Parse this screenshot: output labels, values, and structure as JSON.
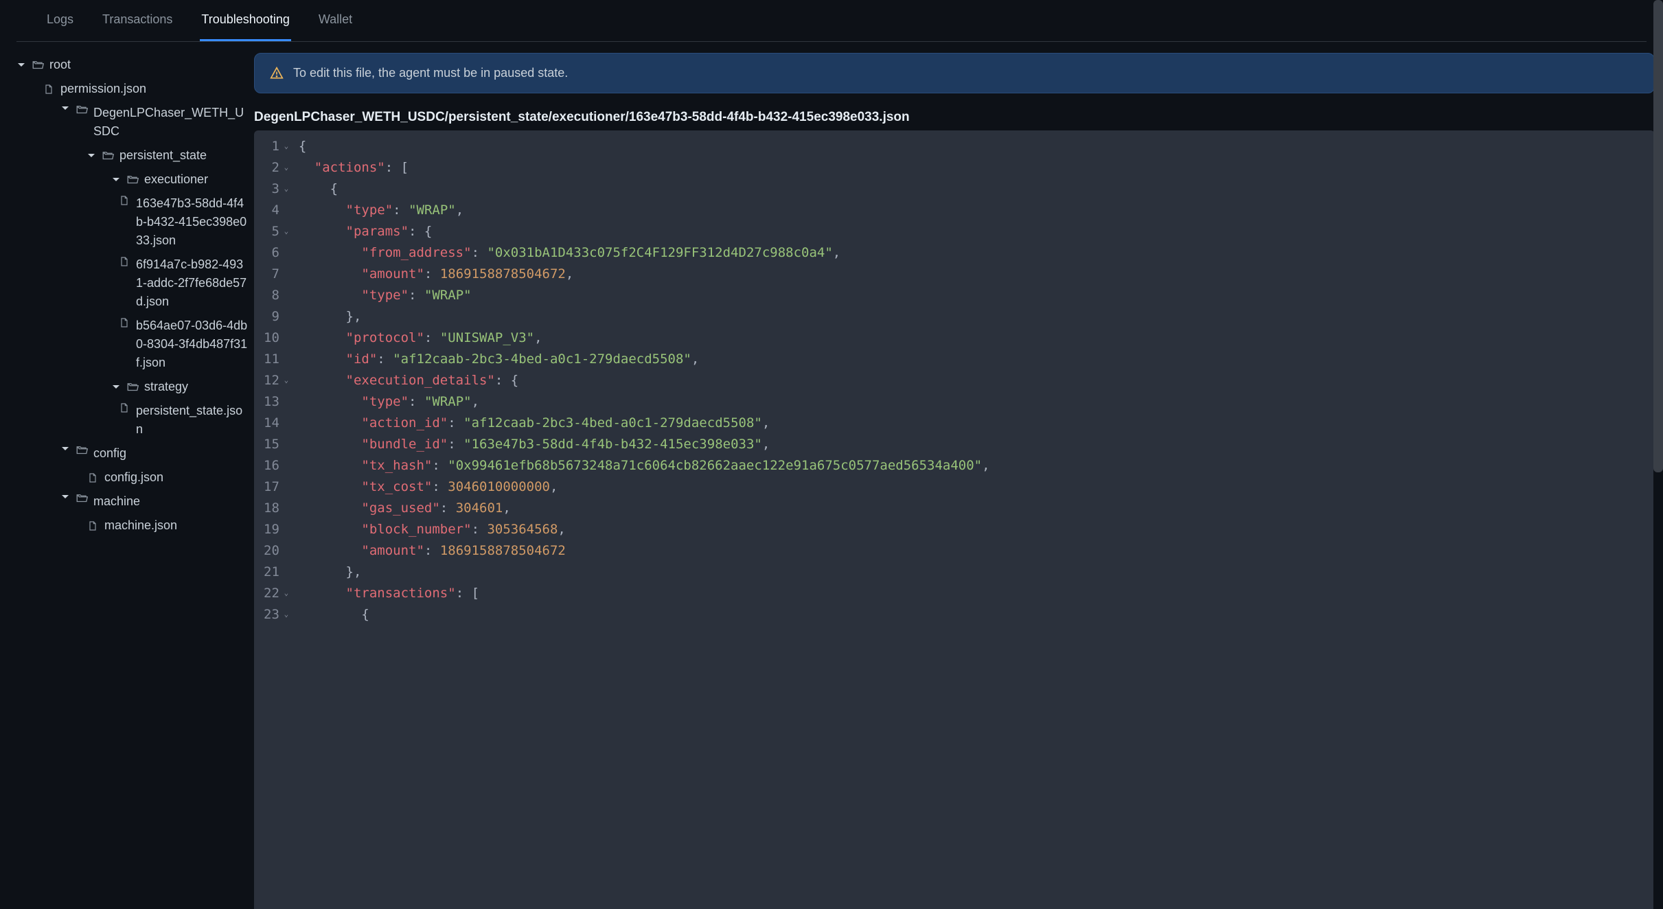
{
  "tabs": {
    "items": [
      {
        "label": "Logs",
        "active": false
      },
      {
        "label": "Transactions",
        "active": false
      },
      {
        "label": "Troubleshooting",
        "active": true
      },
      {
        "label": "Wallet",
        "active": false
      }
    ]
  },
  "sidebar": {
    "tree": [
      {
        "indent": 0,
        "kind": "folder",
        "expanded": true,
        "label": "root"
      },
      {
        "indent": 1,
        "kind": "file",
        "label": "permission.json"
      },
      {
        "indent": 2,
        "kind": "folder",
        "expanded": true,
        "label": "DegenLPChaser_WETH_USDC"
      },
      {
        "indent": 3,
        "kind": "folder",
        "expanded": true,
        "label": "persistent_state"
      },
      {
        "indent": 4,
        "kind": "folder",
        "expanded": true,
        "label": "executioner"
      },
      {
        "indent": 5,
        "kind": "file",
        "label": "163e47b3-58dd-4f4b-b432-415ec398e033.json"
      },
      {
        "indent": 5,
        "kind": "file",
        "label": "6f914a7c-b982-4931-addc-2f7fe68de57d.json"
      },
      {
        "indent": 5,
        "kind": "file",
        "label": "b564ae07-03d6-4db0-8304-3f4db487f31f.json"
      },
      {
        "indent": 4,
        "kind": "folder",
        "expanded": true,
        "label": "strategy"
      },
      {
        "indent": 5,
        "kind": "file",
        "label": "persistent_state.json"
      },
      {
        "indent": 2,
        "kind": "folder",
        "expanded": true,
        "label": "config"
      },
      {
        "indent": 3,
        "kind": "file",
        "label": "config.json"
      },
      {
        "indent": 2,
        "kind": "folder",
        "expanded": true,
        "label": "machine"
      },
      {
        "indent": 3,
        "kind": "file",
        "label": "machine.json"
      }
    ]
  },
  "alert": {
    "text": "To edit this file, the agent must be in paused state."
  },
  "file": {
    "path": "DegenLPChaser_WETH_USDC/persistent_state/executioner/163e47b3-58dd-4f4b-b432-415ec398e033.json"
  },
  "editor": {
    "lines": [
      {
        "n": 1,
        "fold": true,
        "tokens": [
          [
            "pun",
            "{"
          ]
        ]
      },
      {
        "n": 2,
        "fold": true,
        "tokens": [
          [
            "pun",
            "  "
          ],
          [
            "key",
            "\"actions\""
          ],
          [
            "pun",
            ": ["
          ]
        ]
      },
      {
        "n": 3,
        "fold": true,
        "tokens": [
          [
            "pun",
            "    {"
          ]
        ]
      },
      {
        "n": 4,
        "fold": false,
        "tokens": [
          [
            "pun",
            "      "
          ],
          [
            "key",
            "\"type\""
          ],
          [
            "pun",
            ": "
          ],
          [
            "str",
            "\"WRAP\""
          ],
          [
            "pun",
            ","
          ]
        ]
      },
      {
        "n": 5,
        "fold": true,
        "tokens": [
          [
            "pun",
            "      "
          ],
          [
            "key",
            "\"params\""
          ],
          [
            "pun",
            ": {"
          ]
        ]
      },
      {
        "n": 6,
        "fold": false,
        "tokens": [
          [
            "pun",
            "        "
          ],
          [
            "key",
            "\"from_address\""
          ],
          [
            "pun",
            ": "
          ],
          [
            "str",
            "\"0x031bA1D433c075f2C4F129FF312d4D27c988c0a4\""
          ],
          [
            "pun",
            ","
          ]
        ]
      },
      {
        "n": 7,
        "fold": false,
        "tokens": [
          [
            "pun",
            "        "
          ],
          [
            "key",
            "\"amount\""
          ],
          [
            "pun",
            ": "
          ],
          [
            "num",
            "1869158878504672"
          ],
          [
            "pun",
            ","
          ]
        ]
      },
      {
        "n": 8,
        "fold": false,
        "tokens": [
          [
            "pun",
            "        "
          ],
          [
            "key",
            "\"type\""
          ],
          [
            "pun",
            ": "
          ],
          [
            "str",
            "\"WRAP\""
          ]
        ]
      },
      {
        "n": 9,
        "fold": false,
        "tokens": [
          [
            "pun",
            "      },"
          ]
        ]
      },
      {
        "n": 10,
        "fold": false,
        "tokens": [
          [
            "pun",
            "      "
          ],
          [
            "key",
            "\"protocol\""
          ],
          [
            "pun",
            ": "
          ],
          [
            "str",
            "\"UNISWAP_V3\""
          ],
          [
            "pun",
            ","
          ]
        ]
      },
      {
        "n": 11,
        "fold": false,
        "tokens": [
          [
            "pun",
            "      "
          ],
          [
            "key",
            "\"id\""
          ],
          [
            "pun",
            ": "
          ],
          [
            "str",
            "\"af12caab-2bc3-4bed-a0c1-279daecd5508\""
          ],
          [
            "pun",
            ","
          ]
        ]
      },
      {
        "n": 12,
        "fold": true,
        "tokens": [
          [
            "pun",
            "      "
          ],
          [
            "key",
            "\"execution_details\""
          ],
          [
            "pun",
            ": {"
          ]
        ]
      },
      {
        "n": 13,
        "fold": false,
        "tokens": [
          [
            "pun",
            "        "
          ],
          [
            "key",
            "\"type\""
          ],
          [
            "pun",
            ": "
          ],
          [
            "str",
            "\"WRAP\""
          ],
          [
            "pun",
            ","
          ]
        ]
      },
      {
        "n": 14,
        "fold": false,
        "tokens": [
          [
            "pun",
            "        "
          ],
          [
            "key",
            "\"action_id\""
          ],
          [
            "pun",
            ": "
          ],
          [
            "str",
            "\"af12caab-2bc3-4bed-a0c1-279daecd5508\""
          ],
          [
            "pun",
            ","
          ]
        ]
      },
      {
        "n": 15,
        "fold": false,
        "tokens": [
          [
            "pun",
            "        "
          ],
          [
            "key",
            "\"bundle_id\""
          ],
          [
            "pun",
            ": "
          ],
          [
            "str",
            "\"163e47b3-58dd-4f4b-b432-415ec398e033\""
          ],
          [
            "pun",
            ","
          ]
        ]
      },
      {
        "n": 16,
        "fold": false,
        "tokens": [
          [
            "pun",
            "        "
          ],
          [
            "key",
            "\"tx_hash\""
          ],
          [
            "pun",
            ": "
          ],
          [
            "str",
            "\"0x99461efb68b5673248a71c6064cb82662aaec122e91a675c0577aed56534a400\""
          ],
          [
            "pun",
            ","
          ]
        ]
      },
      {
        "n": 17,
        "fold": false,
        "tokens": [
          [
            "pun",
            "        "
          ],
          [
            "key",
            "\"tx_cost\""
          ],
          [
            "pun",
            ": "
          ],
          [
            "num",
            "3046010000000"
          ],
          [
            "pun",
            ","
          ]
        ]
      },
      {
        "n": 18,
        "fold": false,
        "tokens": [
          [
            "pun",
            "        "
          ],
          [
            "key",
            "\"gas_used\""
          ],
          [
            "pun",
            ": "
          ],
          [
            "num",
            "304601"
          ],
          [
            "pun",
            ","
          ]
        ]
      },
      {
        "n": 19,
        "fold": false,
        "tokens": [
          [
            "pun",
            "        "
          ],
          [
            "key",
            "\"block_number\""
          ],
          [
            "pun",
            ": "
          ],
          [
            "num",
            "305364568"
          ],
          [
            "pun",
            ","
          ]
        ]
      },
      {
        "n": 20,
        "fold": false,
        "tokens": [
          [
            "pun",
            "        "
          ],
          [
            "key",
            "\"amount\""
          ],
          [
            "pun",
            ": "
          ],
          [
            "num",
            "1869158878504672"
          ]
        ]
      },
      {
        "n": 21,
        "fold": false,
        "tokens": [
          [
            "pun",
            "      },"
          ]
        ]
      },
      {
        "n": 22,
        "fold": true,
        "tokens": [
          [
            "pun",
            "      "
          ],
          [
            "key",
            "\"transactions\""
          ],
          [
            "pun",
            ": ["
          ]
        ]
      },
      {
        "n": 23,
        "fold": true,
        "tokens": [
          [
            "pun",
            "        {"
          ]
        ]
      }
    ]
  }
}
